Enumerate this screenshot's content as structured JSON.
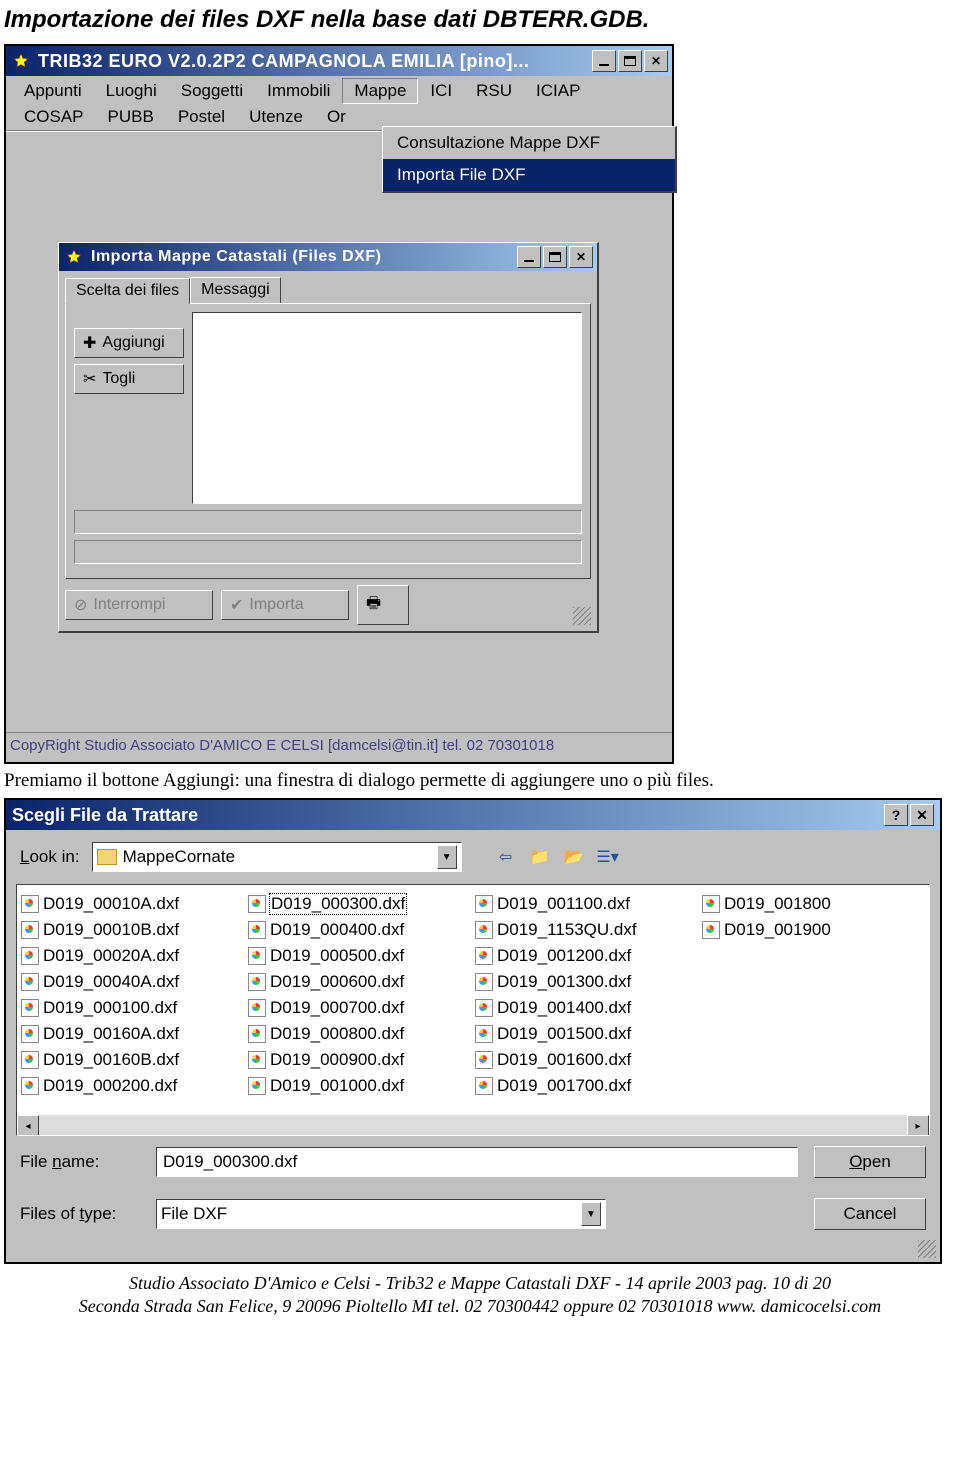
{
  "page_heading": "Importazione dei files DXF nella base dati DBTERR.GDB.",
  "app": {
    "title": "TRIB32 EURO V2.0.2P2 CAMPAGNOLA EMILIA [pino]...",
    "menu_row1": [
      "Appunti",
      "Luoghi",
      "Soggetti",
      "Immobili",
      "Mappe",
      "ICI",
      "RSU",
      "ICIAP"
    ],
    "menu_row2": [
      "COSAP",
      "PUBB",
      "Postel",
      "Utenze",
      "Or"
    ],
    "dropdown": {
      "item1": "Consultazione Mappe DXF",
      "item2": "Importa File DXF"
    },
    "import_window": {
      "title": "Importa Mappe Catastali (Files DXF)",
      "tab1": "Scelta dei files",
      "tab2": "Messaggi",
      "btn_add": "Aggiungi",
      "btn_remove": "Togli",
      "btn_interrupt": "Interrompi",
      "btn_import": "Importa"
    },
    "statusbar": "CopyRight Studio Associato D'AMICO E CELSI [damcelsi@tin.it] tel. 02 70301018"
  },
  "para2": "Premiamo il bottone Aggiungi: una finestra di dialogo permette di aggiungere uno o più files.",
  "filedlg": {
    "title": "Scegli File da Trattare",
    "lookin_label": "Look in:",
    "lookin_value": "MappeCornate",
    "files_col1": [
      "D019_00010A.dxf",
      "D019_00010B.dxf",
      "D019_00020A.dxf",
      "D019_00040A.dxf",
      "D019_000100.dxf",
      "D019_00160A.dxf",
      "D019_00160B.dxf",
      "D019_000200.dxf"
    ],
    "files_col2": [
      "D019_000300.dxf",
      "D019_000400.dxf",
      "D019_000500.dxf",
      "D019_000600.dxf",
      "D019_000700.dxf",
      "D019_000800.dxf",
      "D019_000900.dxf",
      "D019_001000.dxf"
    ],
    "files_col3": [
      "D019_001100.dxf",
      "D019_1153QU.dxf",
      "D019_001200.dxf",
      "D019_001300.dxf",
      "D019_001400.dxf",
      "D019_001500.dxf",
      "D019_001600.dxf",
      "D019_001700.dxf"
    ],
    "files_col4": [
      "D019_001800",
      "D019_001900"
    ],
    "selected": "D019_000300.dxf",
    "filename_label": "File name:",
    "filename_value": "D019_000300.dxf",
    "filetype_label": "Files of type:",
    "filetype_value": "File DXF",
    "btn_open": "pen",
    "btn_open_u": "O",
    "btn_cancel": "Cancel"
  },
  "footer": {
    "line1": "Studio Associato D'Amico e Celsi - Trib32 e Mappe Catastali DXF - 14 aprile 2003 pag. 10 di 20",
    "line2": "Seconda Strada San Felice, 9 20096 Pioltello MI tel. 02 70300442 oppure 02 70301018 www. damicocelsi.com"
  }
}
